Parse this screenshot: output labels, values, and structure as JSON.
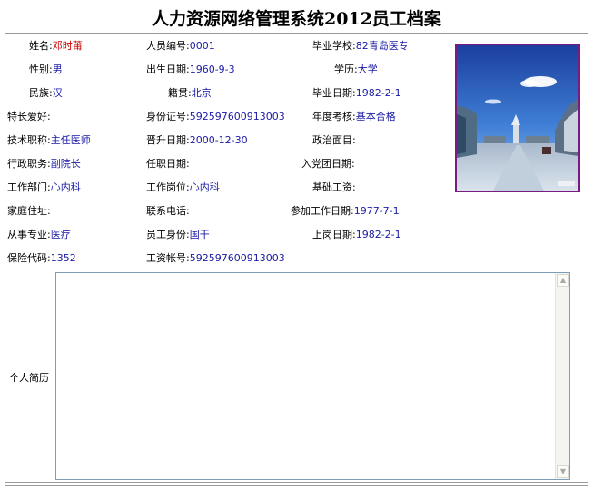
{
  "title": "人力资源网络管理系统2012员工档案",
  "fields": {
    "name": {
      "label": "姓名:",
      "value": "邓时莆"
    },
    "gender": {
      "label": "性别:",
      "value": "男"
    },
    "ethnicity": {
      "label": "民族:",
      "value": "汉"
    },
    "specialty": {
      "label": "特长爱好:",
      "value": ""
    },
    "tech_title": {
      "label": "技术职称:",
      "value": "主任医师"
    },
    "admin_post": {
      "label": "行政职务:",
      "value": "副院长"
    },
    "department": {
      "label": "工作部门:",
      "value": "心内科"
    },
    "address": {
      "label": "家庭住址:",
      "value": ""
    },
    "profession": {
      "label": "从事专业:",
      "value": "医疗"
    },
    "insurance": {
      "label": "保险代码:",
      "value": "1352"
    },
    "emp_no": {
      "label": "人员编号:",
      "value": "0001"
    },
    "birth_date": {
      "label": "出生日期:",
      "value": "1960-9-3"
    },
    "native_place": {
      "label": "籍贯:",
      "value": "北京"
    },
    "id_number": {
      "label": "身份证号:",
      "value": "592597600913003"
    },
    "promo_date": {
      "label": "晋升日期:",
      "value": "2000-12-30"
    },
    "appoint_date": {
      "label": "任职日期:",
      "value": ""
    },
    "position": {
      "label": "工作岗位:",
      "value": "心内科"
    },
    "phone": {
      "label": "联系电话:",
      "value": ""
    },
    "emp_status": {
      "label": "员工身份:",
      "value": "国干"
    },
    "salary_acct": {
      "label": "工资帐号:",
      "value": "592597600913003"
    },
    "school": {
      "label": "毕业学校:",
      "value": "82青岛医专"
    },
    "education": {
      "label": "学历:",
      "value": "大学"
    },
    "grad_date": {
      "label": "毕业日期:",
      "value": "1982-2-1"
    },
    "annual_eval": {
      "label": "年度考核:",
      "value": "基本合格"
    },
    "political": {
      "label": "政治面目:",
      "value": ""
    },
    "party_date": {
      "label": "入党团日期:",
      "value": ""
    },
    "base_salary": {
      "label": "基础工资:",
      "value": ""
    },
    "work_start": {
      "label": "参加工作日期:",
      "value": "1977-7-1"
    },
    "onboard_date": {
      "label": "上岗日期:",
      "value": "1982-2-1"
    }
  },
  "resume": {
    "label": "个人简历",
    "value": ""
  },
  "colors": {
    "value_text": "#1a1aa6",
    "name_text": "#cc0000",
    "photo_border": "#7a1a82"
  }
}
